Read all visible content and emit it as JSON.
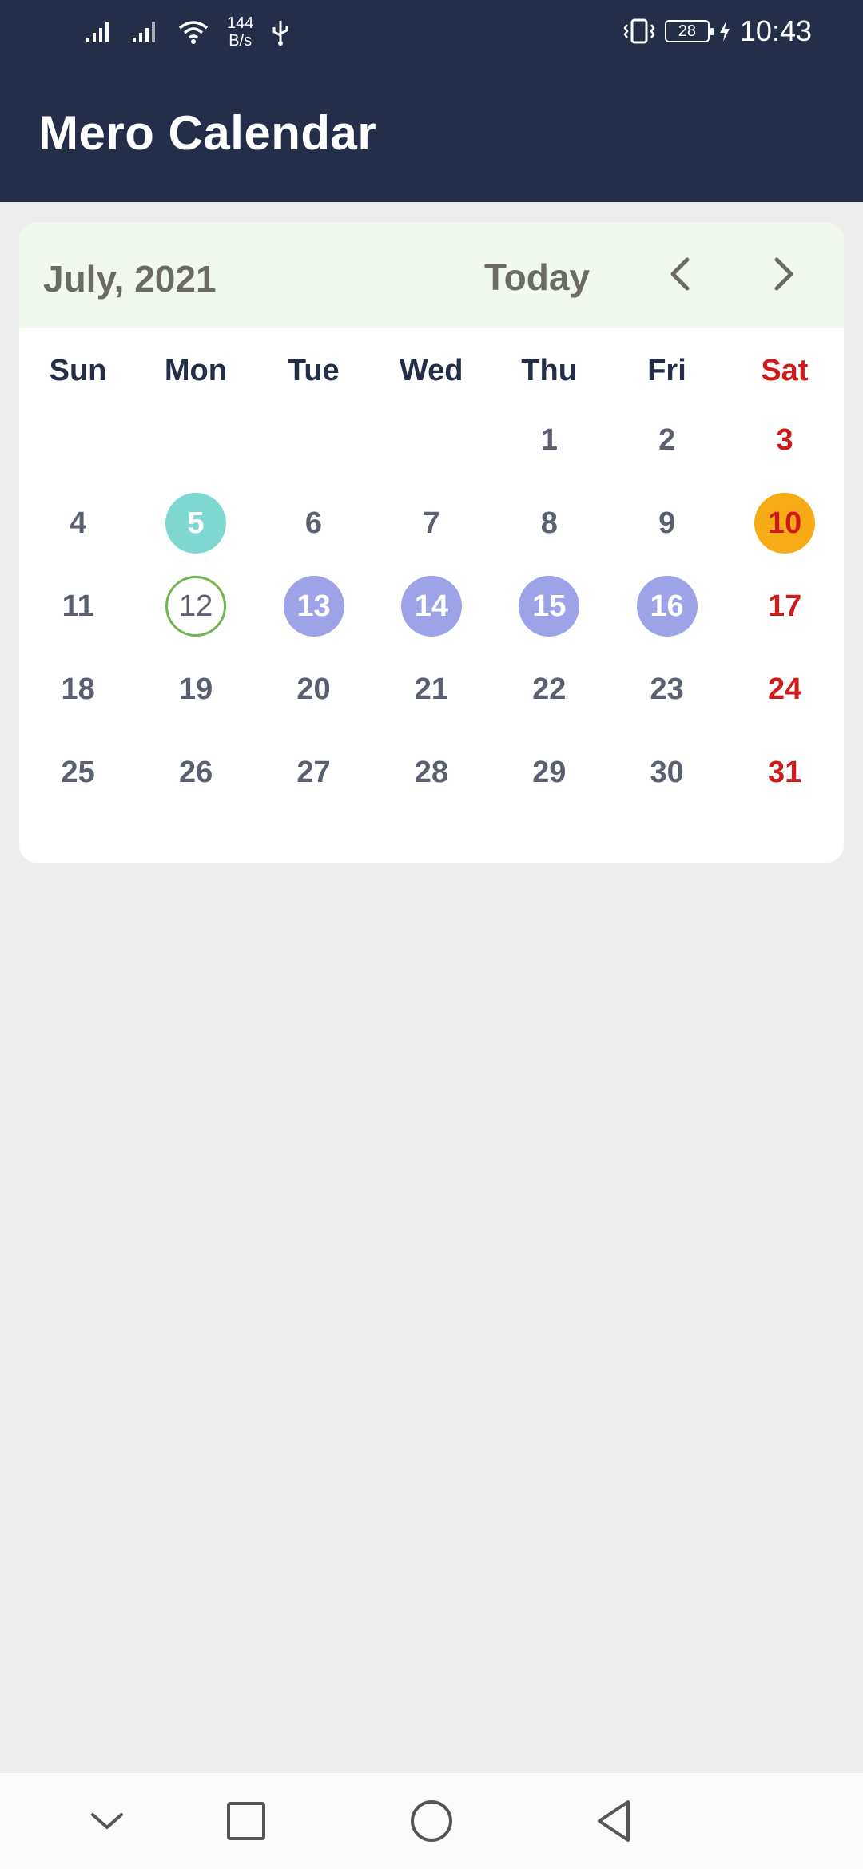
{
  "status_bar": {
    "net_speed_value": "144",
    "net_speed_unit": "B/s",
    "battery_level": "28",
    "time": "10:43"
  },
  "app": {
    "title": "Mero Calendar"
  },
  "calendar": {
    "month_label": "July, 2021",
    "today_label": "Today",
    "weekdays": [
      "Sun",
      "Mon",
      "Tue",
      "Wed",
      "Thu",
      "Fri",
      "Sat"
    ],
    "weeks": [
      [
        "",
        "",
        "",
        "",
        "1",
        "2",
        "3"
      ],
      [
        "4",
        "5",
        "6",
        "7",
        "8",
        "9",
        "10"
      ],
      [
        "11",
        "12",
        "13",
        "14",
        "15",
        "16",
        "17"
      ],
      [
        "18",
        "19",
        "20",
        "21",
        "22",
        "23",
        "24"
      ],
      [
        "25",
        "26",
        "27",
        "28",
        "29",
        "30",
        "31"
      ]
    ],
    "highlights": {
      "5": "teal",
      "10": "orange",
      "12": "today",
      "13": "purple",
      "14": "purple",
      "15": "purple",
      "16": "purple"
    },
    "colors": {
      "header_bg": "#252e48",
      "saturday": "#d01a1a",
      "teal": "#7fd8cf",
      "orange": "#f7ab17",
      "purple": "#9ea2e6",
      "today_ring": "#71b54d"
    }
  },
  "nav_bar": {
    "icons": [
      "chevron-down-icon",
      "square-recents-icon",
      "circle-home-icon",
      "triangle-back-icon"
    ]
  }
}
